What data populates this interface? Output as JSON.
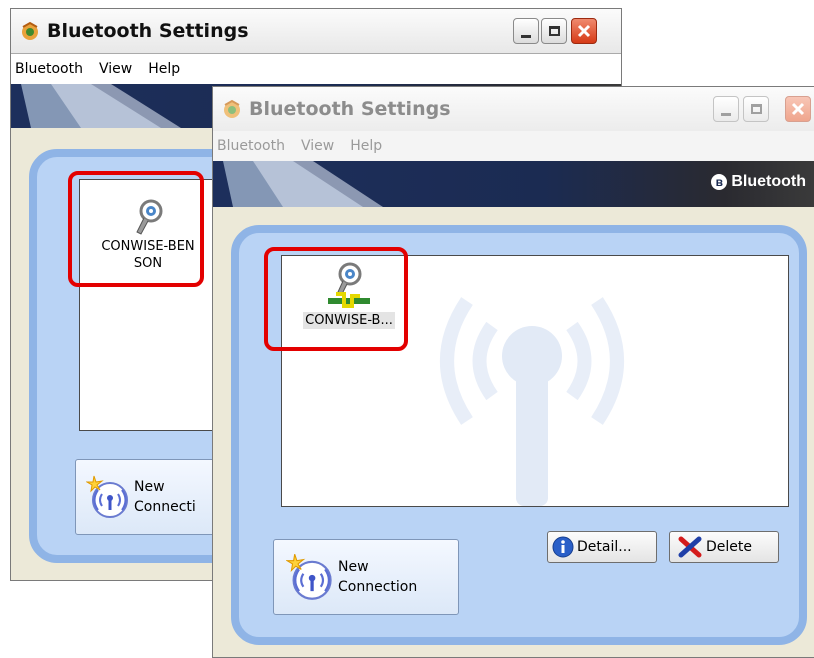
{
  "back_window": {
    "title": "Bluetooth Settings",
    "menu": [
      "Bluetooth",
      "View",
      "Help"
    ],
    "device": {
      "name_line1": "CONWISE-BEN",
      "name_line2": "SON"
    },
    "new_connection": {
      "line1": "New",
      "line2": "Connecti"
    }
  },
  "front_window": {
    "title": "Bluetooth Settings",
    "menu": [
      "Bluetooth",
      "View",
      "Help"
    ],
    "brand": "Bluetooth",
    "brand_mark": "ʙ",
    "device": {
      "name": "CONWISE-B..."
    },
    "new_connection": {
      "line1": "New",
      "line2": "Connection"
    },
    "detail_label": "Detail...",
    "delete_label": "Delete"
  },
  "colors": {
    "highlight": "#e30000",
    "panel_fill": "#b9d3f5",
    "panel_border": "#8fb4e6",
    "banner": "#1b2b52"
  },
  "icons": [
    "bluetooth-app-icon",
    "headset-icon",
    "connected-link-icon",
    "new-connection-icon",
    "info-icon",
    "delete-x-icon",
    "bluetooth-logo-icon"
  ]
}
